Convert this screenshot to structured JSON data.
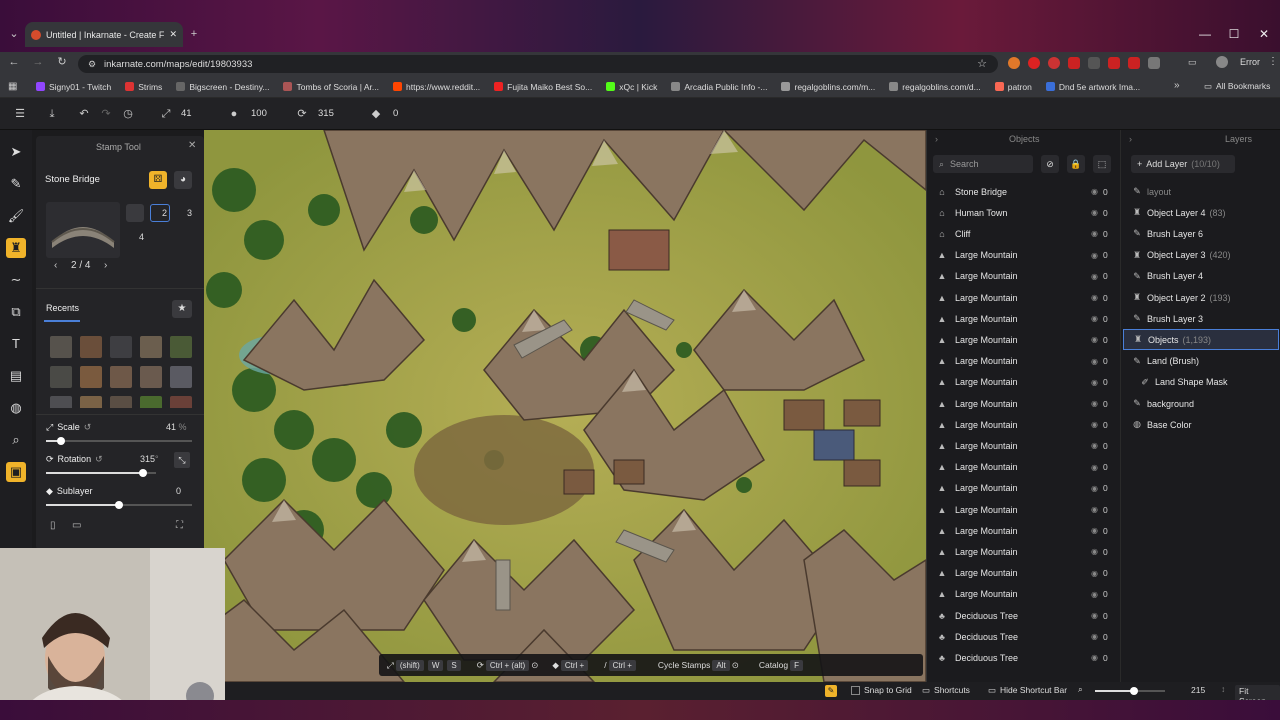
{
  "browser": {
    "tab_title": "Untitled | Inkarnate - Create Fa",
    "url": "inkarnate.com/maps/edit/19803933",
    "error_label": "Error",
    "bookmarks": [
      "Signy01 - Twitch",
      "Strims",
      "Bigscreen - Destiny...",
      "Tombs of Scoria | Ar...",
      "https://www.reddit...",
      "Fujita Maiko Best So...",
      "xQc | Kick",
      "Arcadia Public Info -...",
      "regalgoblins.com/m...",
      "regalgoblins.com/d...",
      "patron",
      "Dnd 5e artwork Ima..."
    ],
    "all_bookmarks": "All Bookmarks"
  },
  "toolbar": {
    "scale_value": "41",
    "opacity_value": "100",
    "rotation_value": "315",
    "layer_value": "0"
  },
  "stamp_panel": {
    "header": "Stamp Tool",
    "asset_name": "Stone Bridge",
    "variants": [
      "2",
      "3",
      "4"
    ],
    "pager": "2 / 4",
    "recents_label": "Recents",
    "scale_label": "Scale",
    "scale_value": "41",
    "scale_unit": "%",
    "scale_fraction": 0.1,
    "rotation_label": "Rotation",
    "rotation_value": "315",
    "rotation_unit": "°",
    "rotation_fraction": 0.88,
    "sublayer_label": "Sublayer",
    "sublayer_value": "0",
    "sublayer_fraction": 0.5
  },
  "objects_panel": {
    "title": "Objects",
    "search_placeholder": "Search",
    "items": [
      {
        "name": "Stone Bridge",
        "count": "0"
      },
      {
        "name": "Human Town",
        "count": "0"
      },
      {
        "name": "Cliff",
        "count": "0"
      },
      {
        "name": "Large Mountain",
        "count": "0"
      },
      {
        "name": "Large Mountain",
        "count": "0"
      },
      {
        "name": "Large Mountain",
        "count": "0"
      },
      {
        "name": "Large Mountain",
        "count": "0"
      },
      {
        "name": "Large Mountain",
        "count": "0"
      },
      {
        "name": "Large Mountain",
        "count": "0"
      },
      {
        "name": "Large Mountain",
        "count": "0"
      },
      {
        "name": "Large Mountain",
        "count": "0"
      },
      {
        "name": "Large Mountain",
        "count": "0"
      },
      {
        "name": "Large Mountain",
        "count": "0"
      },
      {
        "name": "Large Mountain",
        "count": "0"
      },
      {
        "name": "Large Mountain",
        "count": "0"
      },
      {
        "name": "Large Mountain",
        "count": "0"
      },
      {
        "name": "Large Mountain",
        "count": "0"
      },
      {
        "name": "Large Mountain",
        "count": "0"
      },
      {
        "name": "Large Mountain",
        "count": "0"
      },
      {
        "name": "Large Mountain",
        "count": "0"
      },
      {
        "name": "Deciduous Tree",
        "count": "0"
      },
      {
        "name": "Deciduous Tree",
        "count": "0"
      },
      {
        "name": "Deciduous Tree",
        "count": "0"
      }
    ]
  },
  "layers_panel": {
    "title": "Layers",
    "add_label": "Add Layer",
    "add_count": "(10/10)",
    "items": [
      {
        "name": "layout",
        "count": "",
        "icon": "brush"
      },
      {
        "name": "Object Layer 4",
        "count": "(83)",
        "icon": "stamp"
      },
      {
        "name": "Brush Layer 6",
        "count": "",
        "icon": "brush"
      },
      {
        "name": "Object Layer 3",
        "count": "(420)",
        "icon": "stamp"
      },
      {
        "name": "Brush Layer 4",
        "count": "",
        "icon": "brush"
      },
      {
        "name": "Object Layer 2",
        "count": "(193)",
        "icon": "stamp"
      },
      {
        "name": "Brush Layer 3",
        "count": "",
        "icon": "brush"
      },
      {
        "name": "Objects",
        "count": "(1,193)",
        "icon": "stamp"
      },
      {
        "name": "Land (Brush)",
        "count": "",
        "icon": "brush"
      },
      {
        "name": "Land Shape Mask",
        "count": "",
        "icon": "mask"
      },
      {
        "name": "background",
        "count": "",
        "icon": "brush"
      },
      {
        "name": "Base Color",
        "count": "",
        "icon": "globe"
      }
    ]
  },
  "shortcut_bar": {
    "shift": "(shift)",
    "w": "W",
    "s": "S",
    "ctrl_alt": "Ctrl + (alt)",
    "ctrl_plus1": "Ctrl +",
    "ctrl_plus2": "Ctrl +",
    "cycle_label": "Cycle Stamps",
    "alt": "Alt",
    "catalog_label": "Catalog",
    "f": "F"
  },
  "bottom_bar": {
    "snap": "Snap to Grid",
    "shortcuts": "Shortcuts",
    "hide_shortcut": "Hide Shortcut Bar",
    "zoom_value": "215",
    "fit": "Fit Screen",
    "zoom_fraction": 0.55
  }
}
